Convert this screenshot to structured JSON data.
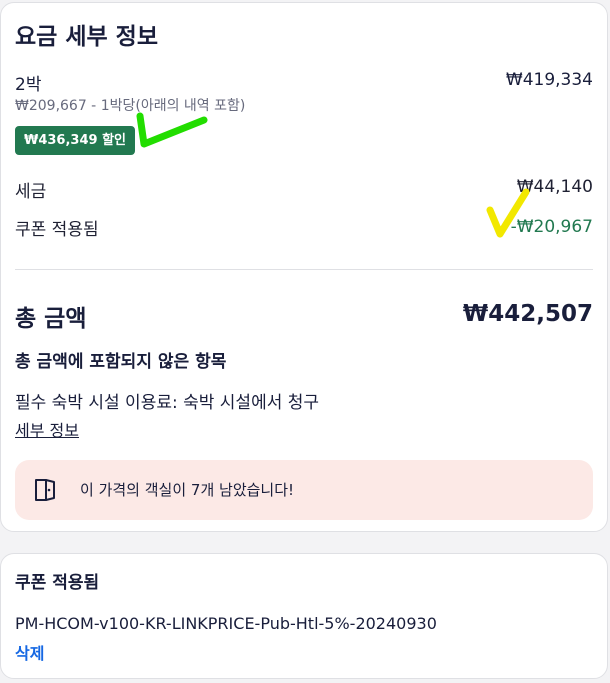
{
  "price_details": {
    "title": "요금 세부 정보",
    "nights_label": "2박",
    "nights_amount": "₩419,334",
    "per_night": "₩209,667 - 1박당(아래의 내역 포함)",
    "discount_badge": "₩436,349 할인",
    "tax_label": "세금",
    "tax_amount": "₩44,140",
    "coupon_label": "쿠폰 적용됨",
    "coupon_amount": "-₩20,967",
    "total_label": "총 금액",
    "total_amount": "₩442,507",
    "excluded_title": "총 금액에 포함되지 않은 항목",
    "excluded_item": "필수 숙박 시설 이용료: 숙박 시설에서 청구",
    "details_link": "세부 정보",
    "notice_icon": "door-icon",
    "notice_text": "이 가격의 객실이 7개 남았습니다!"
  },
  "coupon": {
    "title": "쿠폰 적용됨",
    "code": "PM-HCOM-v100-KR-LINKPRICE-Pub-Htl-5%-20240930",
    "remove_link": "삭제"
  },
  "annotations": {
    "green_mark": "checkmark",
    "yellow_mark": "checkmark"
  },
  "colors": {
    "discount_green": "#227950",
    "link_blue": "#1668e3",
    "notice_bg": "#fce9e6",
    "annotation_green": "#22dd00",
    "annotation_yellow": "#f2e800"
  }
}
